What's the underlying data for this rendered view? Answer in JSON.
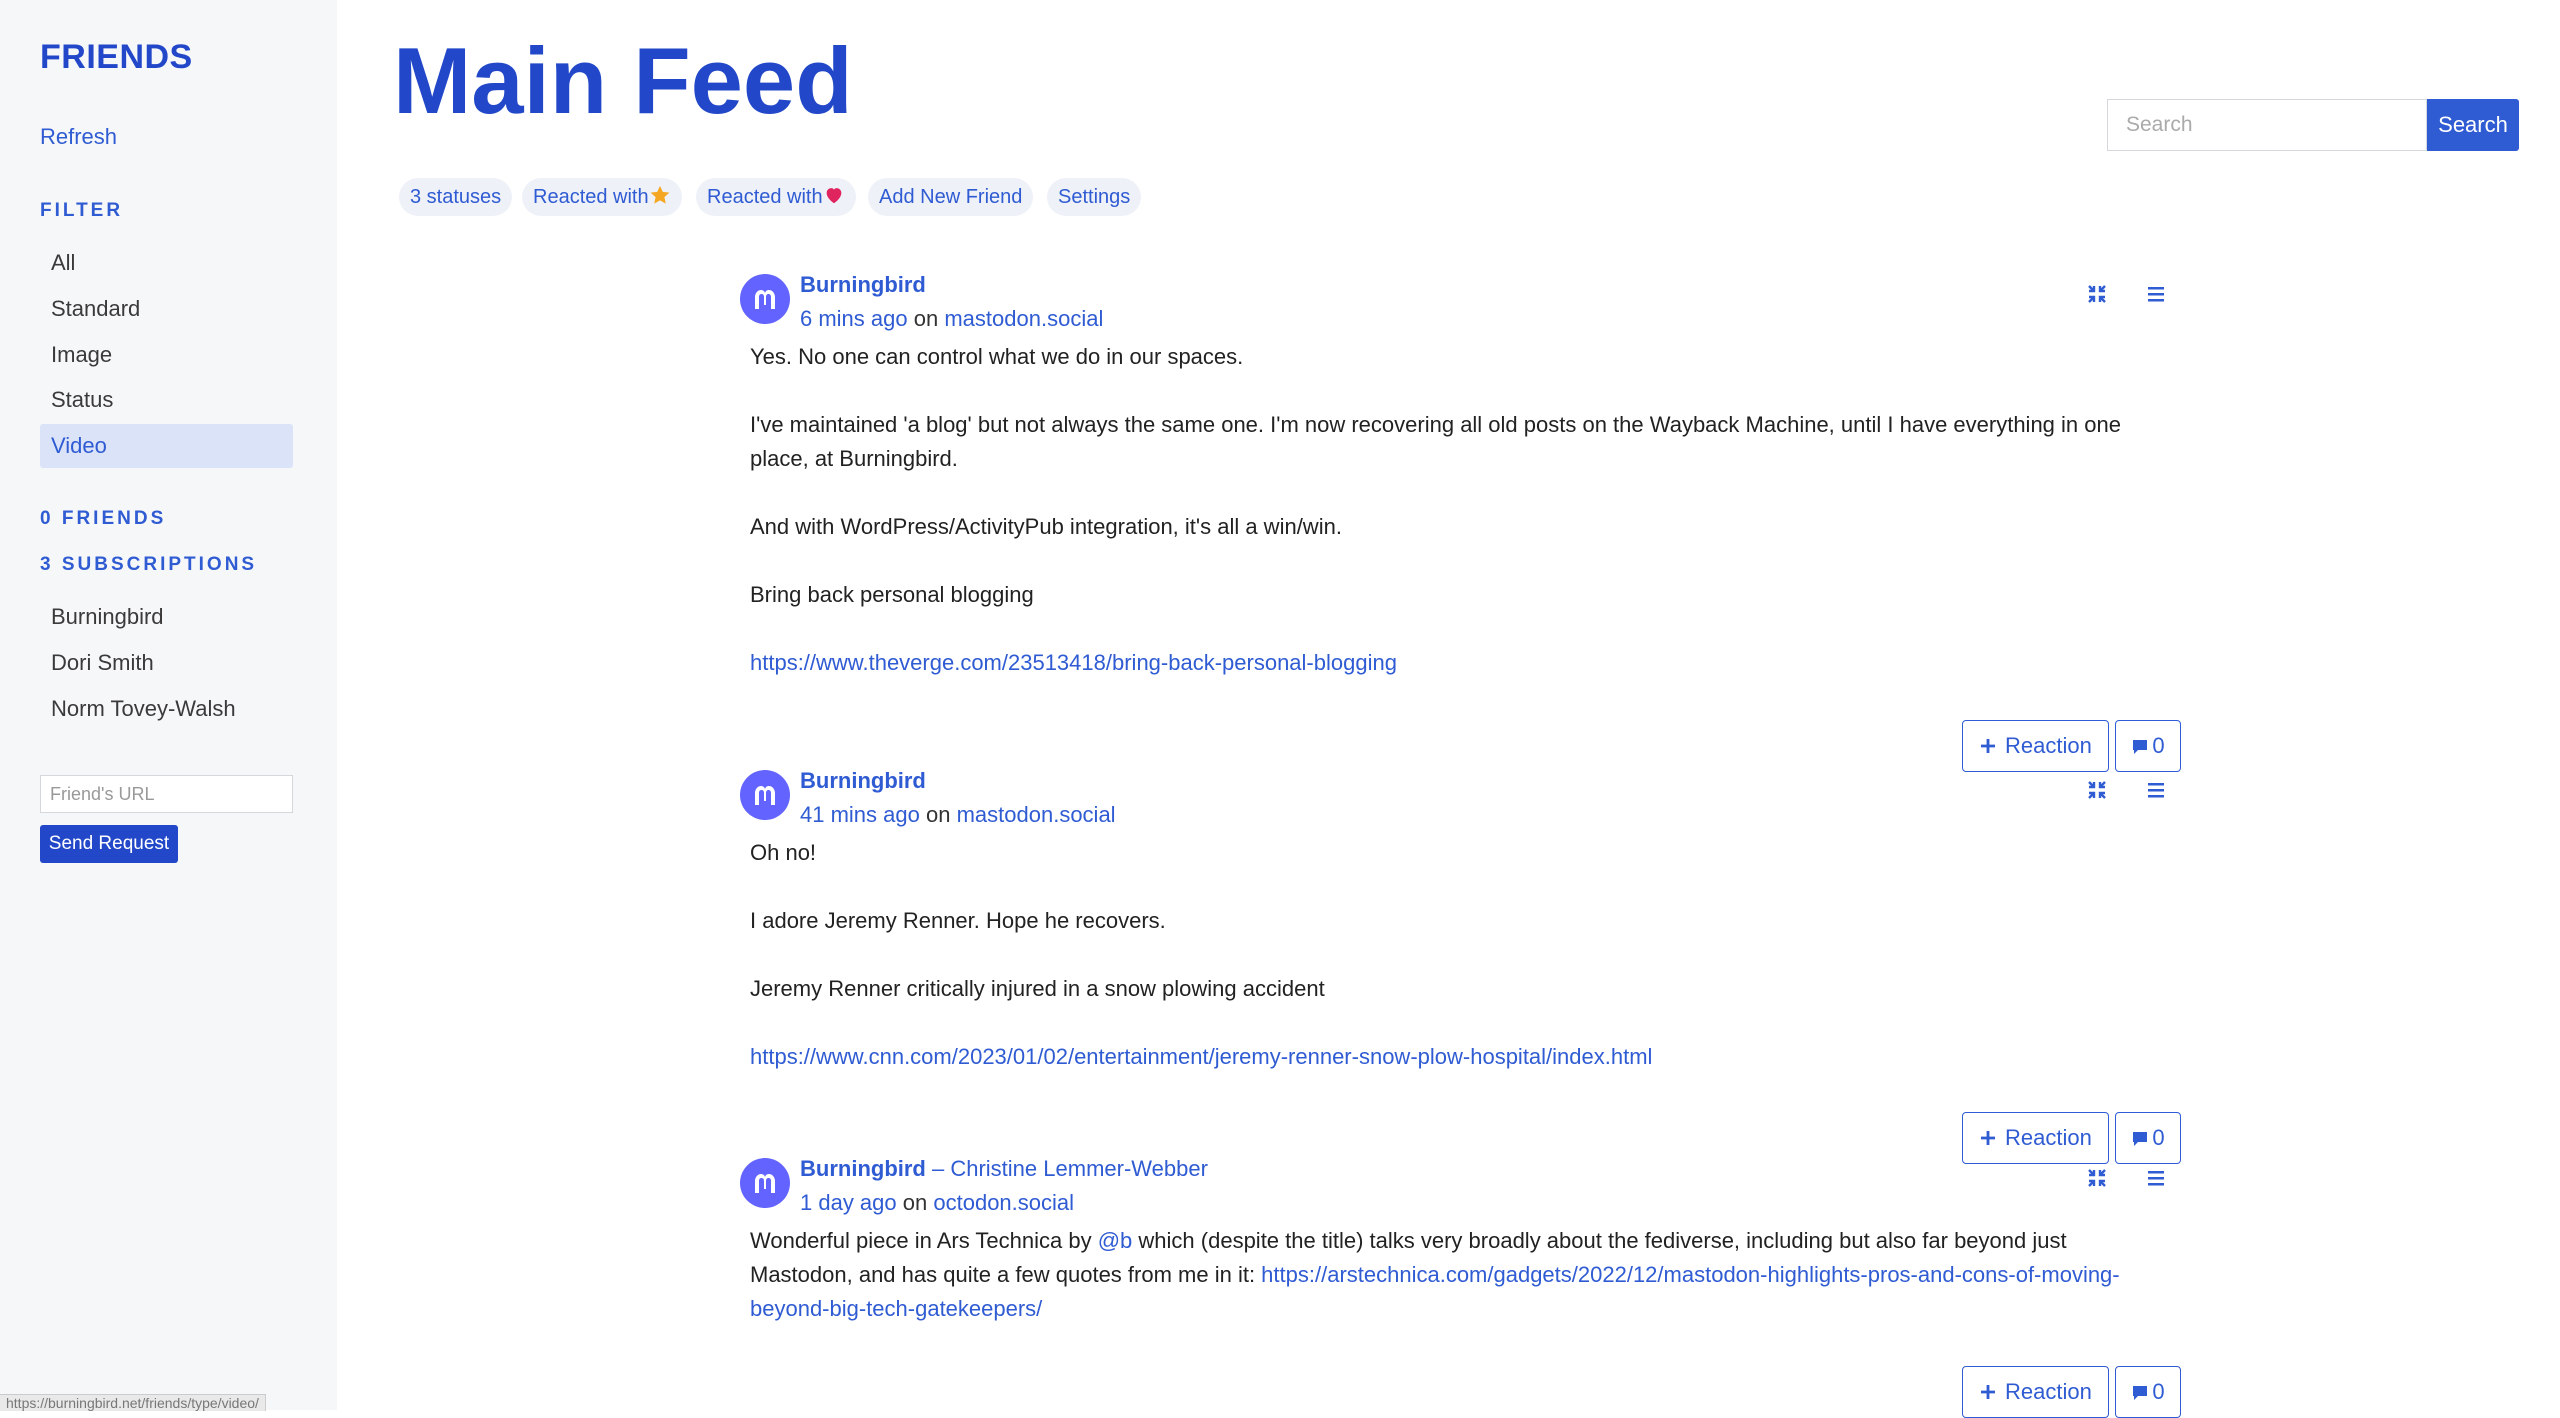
{
  "sidebar": {
    "brand": "FRIENDS",
    "refresh": "Refresh",
    "filter_heading": "FILTER",
    "filters": [
      "All",
      "Standard",
      "Image",
      "Status",
      "Video"
    ],
    "active_filter": "Video",
    "friends_heading": "0 FRIENDS",
    "subscriptions_heading": "3 SUBSCRIPTIONS",
    "subscriptions": [
      "Burningbird",
      "Dori Smith",
      "Norm Tovey-Walsh"
    ],
    "friend_url_placeholder": "Friend's URL",
    "send_request": "Send Request"
  },
  "status_bar_url": "https://burningbird.net/friends/type/video/",
  "header": {
    "title": "Main Feed",
    "search_placeholder": "Search",
    "search_button": "Search"
  },
  "pills": {
    "statuses": "3 statuses",
    "reacted_star": "Reacted with",
    "reacted_heart": "Reacted with",
    "add_friend": "Add New Friend",
    "settings": "Settings"
  },
  "colors": {
    "accent": "#2f5bd3",
    "brand": "#2248c9",
    "mastodon": "#6364ff",
    "star": "#f5a623",
    "heart": "#e0245e"
  },
  "posts": [
    {
      "author": "Burningbird",
      "boosted_from": "",
      "time": "6 mins ago",
      "on": "on",
      "instance": "mastodon.social",
      "paragraphs": [
        "Yes. No one can control what we do in our spaces.",
        "I've maintained 'a blog' but not always the same one. I'm now recovering all old posts on the Wayback Machine, until I have everything in one place, at Burningbird.",
        "And with WordPress/ActivityPub integration, it's all a win/win.",
        "Bring back personal blogging"
      ],
      "link": "https://www.theverge.com/23513418/bring-back-personal-blogging",
      "reaction_label": "Reaction",
      "comment_count": "0"
    },
    {
      "author": "Burningbird",
      "boosted_from": "",
      "time": "41 mins ago",
      "on": "on",
      "instance": "mastodon.social",
      "paragraphs": [
        "Oh no!",
        "I adore Jeremy Renner. Hope he recovers.",
        "Jeremy Renner critically injured in a snow plowing accident"
      ],
      "link": "https://www.cnn.com/2023/01/02/entertainment/jeremy-renner-snow-plow-hospital/index.html",
      "reaction_label": "Reaction",
      "comment_count": "0"
    },
    {
      "author": "Burningbird",
      "boosted_from": "– Christine Lemmer-Webber",
      "time": "1 day ago",
      "on": "on",
      "instance": "octodon.social",
      "text_before": "Wonderful piece in Ars Technica by ",
      "mention": "@b",
      "text_after": " which (despite the title) talks very broadly about the fediverse, including but also far beyond just Mastodon, and has quite a few quotes from me in it: ",
      "link": "https://arstechnica.com/gadgets/2022/12/mastodon-highlights-pros-and-cons-of-moving-beyond-big-tech-gatekeepers/",
      "reaction_label": "Reaction",
      "comment_count": "0"
    }
  ]
}
